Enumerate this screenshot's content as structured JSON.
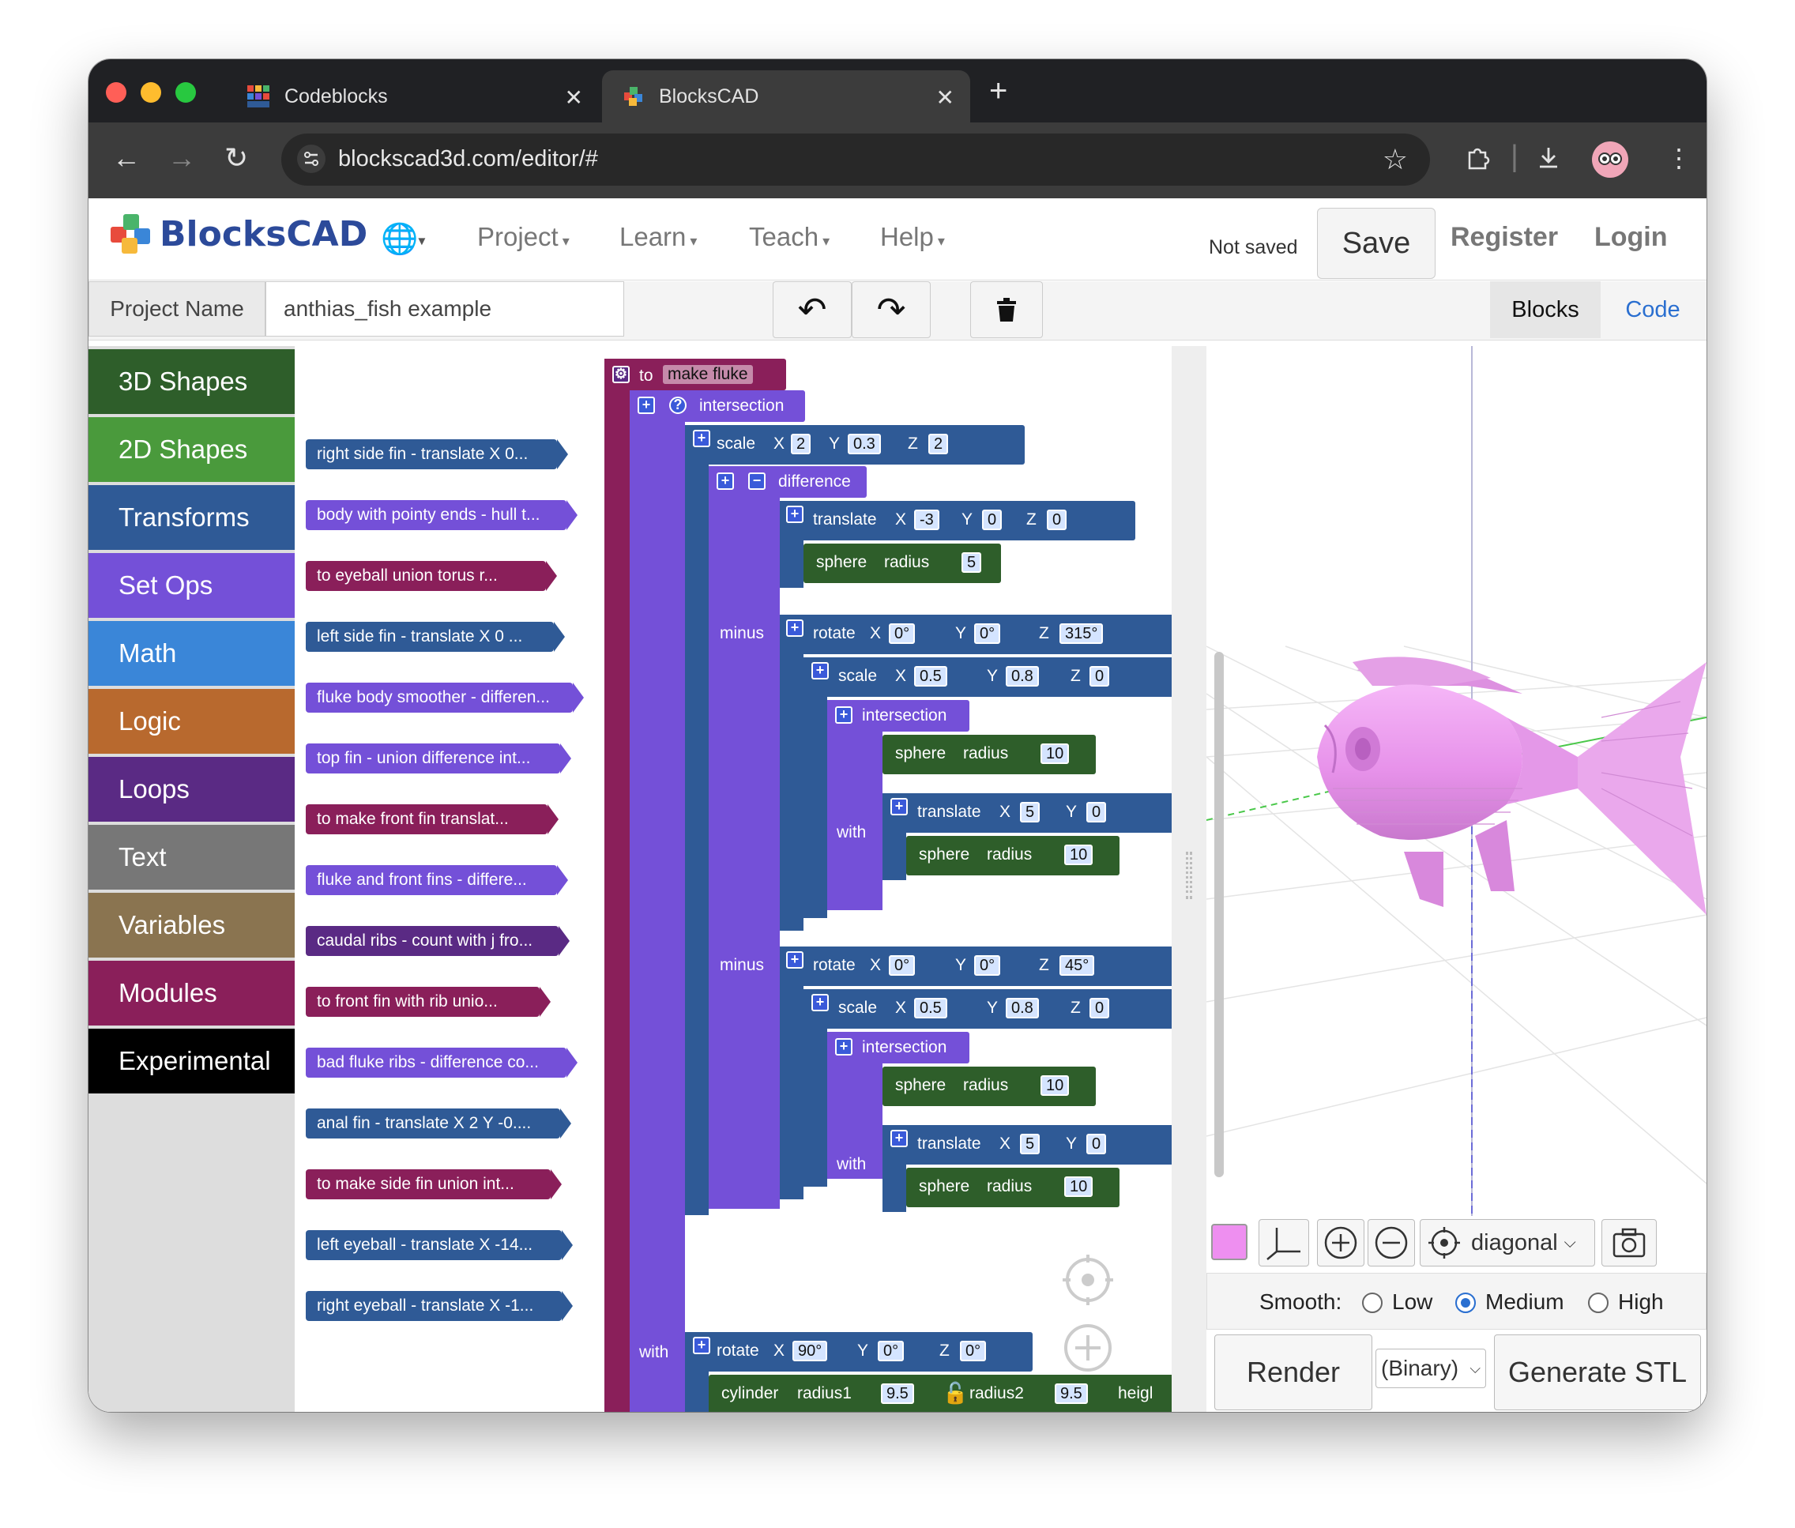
{
  "browser": {
    "tabs": [
      {
        "title": "Codeblocks",
        "active": false
      },
      {
        "title": "BlocksCAD",
        "active": true
      }
    ],
    "url": "blockscad3d.com/editor/#"
  },
  "app": {
    "logo_text": "BlocksCAD",
    "menus": [
      "Project",
      "Learn",
      "Teach",
      "Help"
    ],
    "save_status": "Not saved",
    "save_label": "Save",
    "register_label": "Register",
    "login_label": "Login"
  },
  "project": {
    "label": "Project Name",
    "value": "anthias_fish example",
    "view_tabs": [
      "Blocks",
      "Code"
    ],
    "active_view": "Blocks"
  },
  "categories": [
    {
      "label": "3D Shapes",
      "color": "#2e5e2a"
    },
    {
      "label": "2D Shapes",
      "color": "#4a9a3c"
    },
    {
      "label": "Transforms",
      "color": "#2f5a96"
    },
    {
      "label": "Set Ops",
      "color": "#7450d8"
    },
    {
      "label": "Math",
      "color": "#3a86d8"
    },
    {
      "label": "Logic",
      "color": "#b8692e"
    },
    {
      "label": "Loops",
      "color": "#5a2a84"
    },
    {
      "label": "Text",
      "color": "#777777"
    },
    {
      "label": "Variables",
      "color": "#8a7450"
    },
    {
      "label": "Modules",
      "color": "#8a1f5a"
    },
    {
      "label": "Experimental",
      "color": "#000000"
    }
  ],
  "flyout": [
    {
      "label": "right side fin - translate X 0...",
      "color": "#2f5a96"
    },
    {
      "label": "body with pointy ends - hull t...",
      "color": "#7450d8"
    },
    {
      "label": "to eyeball  union torus   r...",
      "color": "#8a1f5a"
    },
    {
      "label": "left side fin - translate X 0 ...",
      "color": "#2f5a96"
    },
    {
      "label": "fluke body smoother - differen...",
      "color": "#7450d8"
    },
    {
      "label": "top fin - union difference int...",
      "color": "#7450d8"
    },
    {
      "label": "to make front fin  translat...",
      "color": "#8a1f5a"
    },
    {
      "label": "fluke and front fins - differe...",
      "color": "#7450d8"
    },
    {
      "label": "caudal ribs - count with j fro...",
      "color": "#5a2a84"
    },
    {
      "label": "to front fin with rib  unio...",
      "color": "#8a1f5a"
    },
    {
      "label": "bad fluke ribs - difference co...",
      "color": "#7450d8"
    },
    {
      "label": "anal fin - translate X 2 Y -0....",
      "color": "#2f5a96"
    },
    {
      "label": "to make side fin  union int...",
      "color": "#8a1f5a"
    },
    {
      "label": "left eyeball - translate X -14...",
      "color": "#2f5a96"
    },
    {
      "label": "right eyeball - translate X -1...",
      "color": "#2f5a96"
    }
  ],
  "workspace": {
    "func_to": "to",
    "func_name": "make fluke",
    "intersection": "intersection",
    "difference": "difference",
    "minus": "minus",
    "with": "with",
    "scale": "scale",
    "translate": "translate",
    "rotate": "rotate",
    "sphere": "sphere",
    "radius": "radius",
    "cylinder": "cylinder",
    "radius1": "radius1",
    "radius2": "radius2",
    "height_partial": "heigl",
    "ax_x": "X",
    "ax_y": "Y",
    "ax_z": "Z",
    "v_scale1": [
      "2",
      "0.3",
      "2"
    ],
    "v_trans1": [
      "-3",
      "0",
      "0"
    ],
    "v_sphere1": "5",
    "v_rot1": [
      "0°",
      "0°",
      "315°"
    ],
    "v_scale2": [
      "0.5",
      "0.8",
      "0"
    ],
    "v_sphere10": "10",
    "v_trans5": [
      "5",
      "0"
    ],
    "v_rot2": [
      "0°",
      "0°",
      "45°"
    ],
    "v_rot3": [
      "90°",
      "0°",
      "0°"
    ],
    "v_cyl": [
      "9.5",
      "9.5"
    ]
  },
  "viewer": {
    "view_mode": "diagonal",
    "smooth_label": "Smooth:",
    "smooth_options": [
      "Low",
      "Medium",
      "High"
    ],
    "smooth_selected": "Medium",
    "render_label": "Render",
    "format_value": "(Binary)",
    "generate_label": "Generate STL",
    "object_color": "#ee8ff0"
  }
}
